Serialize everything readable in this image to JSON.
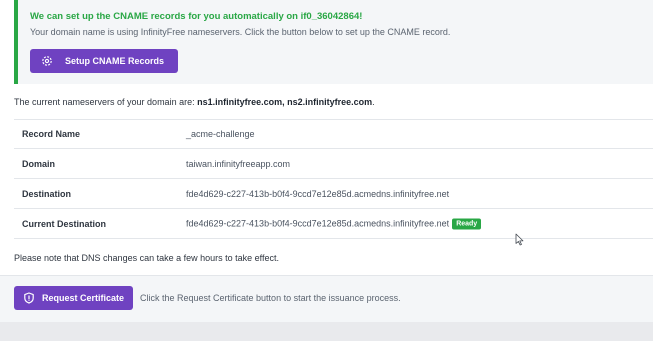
{
  "cname_alert": {
    "title": "We can set up the CNAME records for you automatically on if0_36042864!",
    "text": "Your domain name is using InfinityFree nameservers. Click the button below to set up the CNAME record.",
    "button_label": "Setup CNAME Records",
    "button_icon": "gear-icon"
  },
  "nameservers": {
    "prefix": "The current nameservers of your domain are: ",
    "values": "ns1.infinityfree.com, ns2.infinityfree.com",
    "suffix": "."
  },
  "records": [
    {
      "label": "Record Name",
      "value": "_acme-challenge"
    },
    {
      "label": "Domain",
      "value": "taiwan.infinityfreeapp.com"
    },
    {
      "label": "Destination",
      "value": "fde4d629-c227-413b-b0f4-9ccd7e12e85d.acmedns.infinityfree.net"
    },
    {
      "label": "Current Destination",
      "value": "fde4d629-c227-413b-b0f4-9ccd7e12e85d.acmedns.infinityfree.net",
      "badge": "Ready"
    }
  ],
  "dns_note": "Please note that DNS changes can take a few hours to take effect.",
  "request": {
    "button_label": "Request Certificate",
    "button_icon": "shield-icon",
    "help_text": "Click the Request Certificate button to start the issuance process."
  },
  "colors": {
    "accent_purple": "#6f42c1",
    "success_green": "#29a745",
    "alert_background": "#f4f6f8"
  }
}
